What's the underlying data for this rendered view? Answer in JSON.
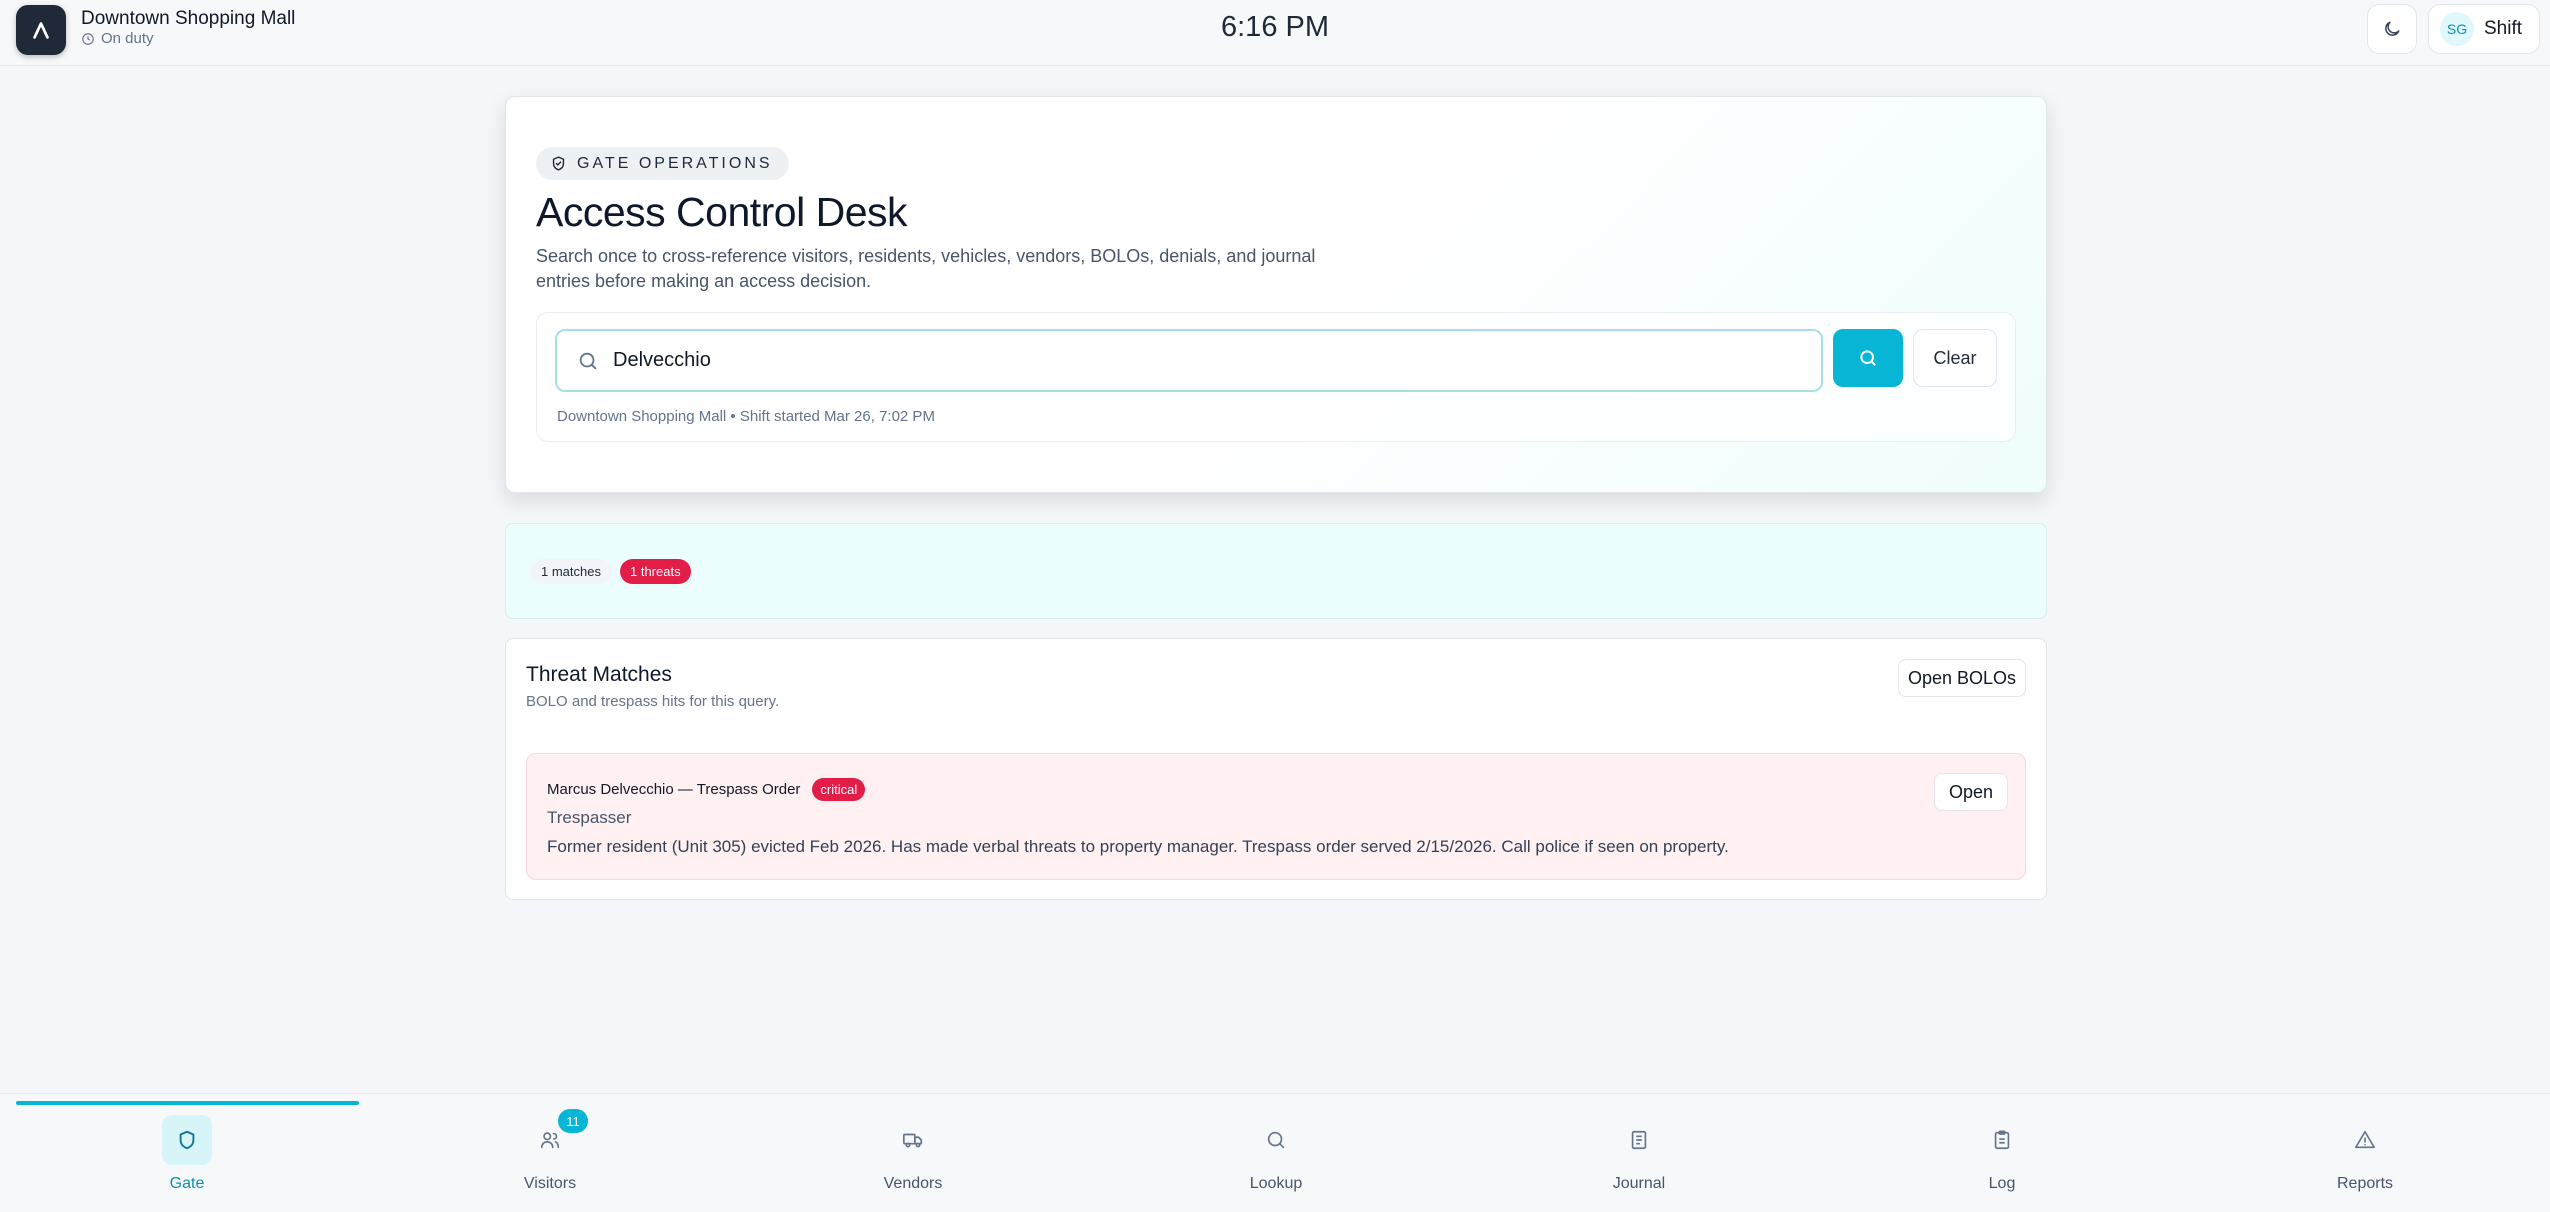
{
  "header": {
    "site_name": "Downtown Shopping Mall",
    "status": "On duty",
    "clock": "6:16 PM",
    "user_initials": "SG",
    "user_label": "Shift"
  },
  "hero": {
    "badge": "GATE OPERATIONS",
    "title": "Access Control Desk",
    "description": "Search once to cross-reference visitors, residents, vehicles, vendors, BOLOs, denials, and journal entries before making an access decision.",
    "search_value": "Delvecchio",
    "clear_label": "Clear",
    "meta": "Downtown Shopping Mall • Shift started Mar 26, 7:02 PM"
  },
  "stats": {
    "matches": "1 matches",
    "threats": "1 threats"
  },
  "threats": {
    "title": "Threat Matches",
    "subtitle": "BOLO and trespass hits for this query.",
    "open_bolos_label": "Open BOLOs",
    "items": [
      {
        "name": "Marcus Delvecchio — Trespass Order",
        "severity": "critical",
        "type": "Trespasser",
        "notes": "Former resident (Unit 305) evicted Feb 2026. Has made verbal threats to property manager. Trespass order served 2/15/2026. Call police if seen on property.",
        "open_label": "Open"
      }
    ]
  },
  "nav": {
    "items": [
      {
        "label": "Gate",
        "icon": "shield-icon",
        "active": true
      },
      {
        "label": "Visitors",
        "icon": "users-icon",
        "badge": "11"
      },
      {
        "label": "Vendors",
        "icon": "truck-icon"
      },
      {
        "label": "Lookup",
        "icon": "search-icon"
      },
      {
        "label": "Journal",
        "icon": "book-icon"
      },
      {
        "label": "Log",
        "icon": "clipboard-icon"
      },
      {
        "label": "Reports",
        "icon": "warning-icon"
      }
    ]
  },
  "colors": {
    "accent": "#06b6d4",
    "danger": "#e11d48",
    "background": "#f4f6f9"
  }
}
